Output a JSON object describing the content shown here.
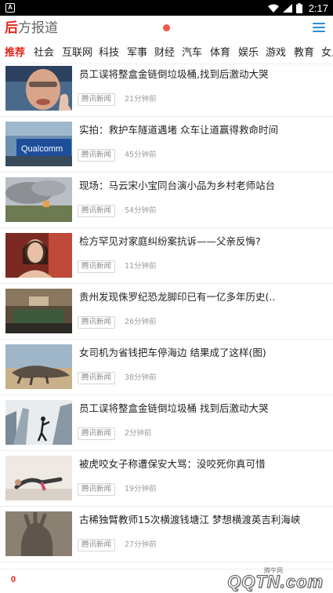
{
  "status_bar": {
    "time": "2:17",
    "notification_icon": "android-icon",
    "icons": [
      "wifi-icon",
      "signal-icon",
      "battery-icon"
    ]
  },
  "header": {
    "logo_first": "后",
    "logo_rest": "方报道",
    "menu_icon": "hamburger-menu-icon"
  },
  "tabs": [
    "推荐",
    "社会",
    "互联网",
    "科技",
    "军事",
    "财经",
    "汽车",
    "体育",
    "娱乐",
    "游戏",
    "教育",
    "女人"
  ],
  "active_tab": 0,
  "articles": [
    {
      "title": "员工误将整盒金链倒垃圾桶,找到后激动大哭",
      "source": "腾讯新闻",
      "time": "21分钟前",
      "thumb": "man-portrait"
    },
    {
      "title": "实拍：救护车隧道遇堵 众车让道赢得救命时间",
      "source": "腾讯新闻",
      "time": "45分钟前",
      "thumb": "qualcomm-sign"
    },
    {
      "title": "现场：马云宋小宝同台演小品为乡村老师站台",
      "source": "腾讯新闻",
      "time": "54分钟前",
      "thumb": "smoke-field"
    },
    {
      "title": "检方罕见对家庭纠纷案抗诉——父亲反悔?",
      "source": "腾讯新闻",
      "time": "11分钟前",
      "thumb": "woman-portrait"
    },
    {
      "title": "贵州发现侏罗纪恐龙脚印已有一亿多年历史(..",
      "source": "腾讯新闻",
      "time": "26分钟前",
      "thumb": "meeting-room"
    },
    {
      "title": "女司机为省钱把车停海边 结果成了这样(图)",
      "source": "腾讯新闻",
      "time": "38分钟前",
      "thumb": "komodo-lizard"
    },
    {
      "title": "员工误将整盒金链倒垃圾桶 找到后激动大哭",
      "source": "腾讯新闻",
      "time": "2分钟前",
      "thumb": "silhouette-buildings"
    },
    {
      "title": "被虎咬女子称遭保安大骂：没咬死你真可惜",
      "source": "腾讯新闻",
      "time": "19分钟前",
      "thumb": "yoga-pose"
    },
    {
      "title": "古稀独臂教师15次横渡钱塘江 梦想横渡英吉利海峡",
      "source": "腾讯新闻",
      "time": "27分钟前",
      "thumb": "hand-sculpture"
    }
  ],
  "bottom_bar": {
    "count": "0",
    "watermark_small": "腾牛网",
    "watermark_big": "QQTN.com"
  },
  "colors": {
    "accent_red": "#e3241b",
    "menu_blue": "#2a8ed8",
    "status_bar": "#000000"
  }
}
